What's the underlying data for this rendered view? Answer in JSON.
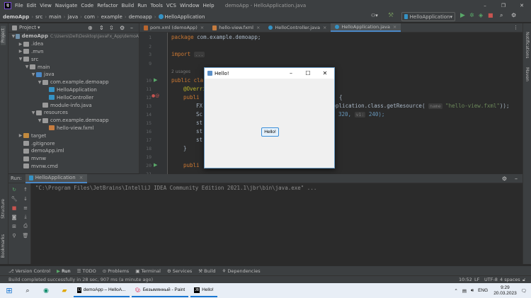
{
  "window": {
    "title": "demoApp - HelloApplication.java"
  },
  "menu": [
    "File",
    "Edit",
    "View",
    "Navigate",
    "Code",
    "Refactor",
    "Build",
    "Run",
    "Tools",
    "VCS",
    "Window",
    "Help"
  ],
  "breadcrumbs": [
    "demoApp",
    "src",
    "main",
    "java",
    "com",
    "example",
    "demoapp",
    "HelloApplication"
  ],
  "run_config": {
    "label": "HelloApplication"
  },
  "project_panel": {
    "title": "Project",
    "tree": [
      {
        "label": "demoApp",
        "extra": "C:\\Users\\Dell\\Desktop\\JavaFx_App\\demoA",
        "indent": 0,
        "arrow": "▼",
        "color": "#6f8fa8"
      },
      {
        "label": ".idea",
        "indent": 1,
        "arrow": "▶",
        "color": "#9a9a9a"
      },
      {
        "label": ".mvn",
        "indent": 1,
        "arrow": "▶",
        "color": "#9a9a9a"
      },
      {
        "label": "src",
        "indent": 1,
        "arrow": "▼",
        "color": "#9a9a9a"
      },
      {
        "label": "main",
        "indent": 2,
        "arrow": "▼",
        "color": "#9a9a9a"
      },
      {
        "label": "java",
        "indent": 3,
        "arrow": "▼",
        "color": "#4a88c7"
      },
      {
        "label": "com.example.demoapp",
        "indent": 4,
        "arrow": "▼",
        "color": "#9a9a9a"
      },
      {
        "label": "HelloApplication",
        "indent": 5,
        "arrow": "",
        "color": "#3592c4"
      },
      {
        "label": "HelloController",
        "indent": 5,
        "arrow": "",
        "color": "#3592c4"
      },
      {
        "label": "module-info.java",
        "indent": 4,
        "arrow": "",
        "color": "#9a9a9a"
      },
      {
        "label": "resources",
        "indent": 3,
        "arrow": "▼",
        "color": "#9a9a9a"
      },
      {
        "label": "com.example.demoapp",
        "indent": 4,
        "arrow": "▼",
        "color": "#9a9a9a"
      },
      {
        "label": "hello-view.fxml",
        "indent": 5,
        "arrow": "",
        "color": "#c67c3f"
      },
      {
        "label": "target",
        "indent": 1,
        "arrow": "▶",
        "color": "#c28a3e"
      },
      {
        "label": ".gitignore",
        "indent": 1,
        "arrow": "",
        "color": "#9a9a9a"
      },
      {
        "label": "demoApp.iml",
        "indent": 1,
        "arrow": "",
        "color": "#9a9a9a"
      },
      {
        "label": "mvnw",
        "indent": 1,
        "arrow": "",
        "color": "#9a9a9a"
      },
      {
        "label": "mvnw.cmd",
        "indent": 1,
        "arrow": "",
        "color": "#9a9a9a"
      }
    ]
  },
  "tabs": [
    {
      "label": "pom.xml (demoApp)",
      "active": false
    },
    {
      "label": "hello-view.fxml",
      "active": false
    },
    {
      "label": "HelloController.java",
      "active": false
    },
    {
      "label": "HelloApplication.java",
      "active": true
    }
  ],
  "editor": {
    "line_numbers": [
      "1",
      "2",
      "3",
      "9",
      "10",
      "11",
      "12",
      "13",
      "14",
      "15",
      "16",
      "17",
      "18",
      "19",
      "20",
      "21"
    ],
    "usages": "2 usages",
    "lines": {
      "l1": "package com.example.demoapp;",
      "l3": "import ...",
      "l10": "public cla",
      "l11": "@Overri",
      "l12": "publi",
      "l12b": "{",
      "l13": "FX",
      "l13b": "Application.class.getResource(",
      "l13hint": "name",
      "l13str": "\"hello-view.fxml\"",
      "l13end": "));",
      "l14": "Sc",
      "l14b": "320,",
      "l14hint": "v1:",
      "l14c": "240);",
      "l15": "st",
      "l16": "st",
      "l17": "st",
      "l18": "}",
      "l20": "publi"
    }
  },
  "hello_window": {
    "title": "Hello!",
    "button": "Hello!"
  },
  "run_panel": {
    "label": "Run:",
    "config": "HelloApplication",
    "command": "\"C:\\Program Files\\JetBrains\\IntelliJ IDEA Community Edition 2021.1\\jbr\\bin\\java.exe\" ..."
  },
  "left_stripe": [
    "Project",
    "Structure",
    "Bookmarks"
  ],
  "right_stripe": [
    "Notifications",
    "Maven"
  ],
  "bottom_tabs": [
    "Version Control",
    "Run",
    "TODO",
    "Problems",
    "Terminal",
    "Services",
    "Build",
    "Dependencies"
  ],
  "status": {
    "message": "Build completed successfully in 28 sec, 907 ms (a minute ago)",
    "position": "10:52",
    "line_sep": "LF",
    "encoding": "UTF-8",
    "indent": "4 spaces"
  },
  "taskbar": {
    "apps": [
      "demoApp – HelloA...",
      "Безымянный - Paint",
      "Hello!"
    ],
    "tray": {
      "lang": "ENG",
      "time": "9:29",
      "date": "20.03.2023"
    }
  }
}
